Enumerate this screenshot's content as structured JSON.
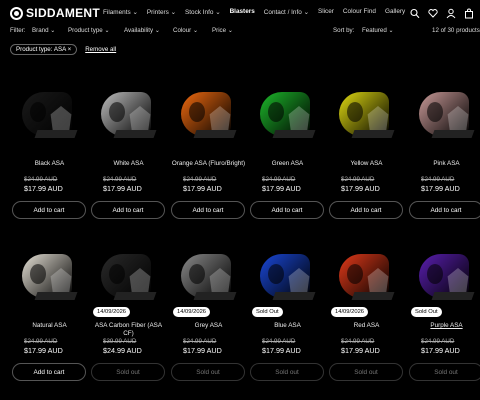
{
  "brand": "SIDDAMENT",
  "nav": [
    "Filaments ⌄",
    "Printers ⌄",
    "Stock Info ⌄",
    "Blasters",
    "Contact / Info ⌄",
    "Slicer",
    "Colour Find",
    "Gallery"
  ],
  "nav_selected": "Blasters",
  "filters": {
    "label": "Filter:",
    "items": [
      "Brand ⌄",
      "Product type ⌄",
      "Availability ⌄",
      "Colour ⌄",
      "Price ⌄"
    ],
    "sort_label": "Sort by:",
    "sort_value": "Featured ⌄",
    "count": "12 of 30 products"
  },
  "active_filter": {
    "chip": "Product type: ASA ×",
    "remove_all": "Remove all"
  },
  "add_label": "Add to cart",
  "soldout_label": "Sold out",
  "products": [
    {
      "name": "Black ASA",
      "old": "$24.99 AUD",
      "new": "$17.99 AUD",
      "color": "#1a1a1a",
      "badge": "",
      "button": "add"
    },
    {
      "name": "White ASA",
      "old": "$24.99 AUD",
      "new": "$17.99 AUD",
      "color": "#bdbdbd",
      "badge": "",
      "button": "add"
    },
    {
      "name": "Orange ASA (Fluro/Bright)",
      "old": "$24.99 AUD",
      "new": "$17.99 AUD",
      "color": "#f06a10",
      "badge": "",
      "button": "add"
    },
    {
      "name": "Green ASA",
      "old": "$24.99 AUD",
      "new": "$17.99 AUD",
      "color": "#1db82b",
      "badge": "",
      "button": "add"
    },
    {
      "name": "Yellow ASA",
      "old": "$24.99 AUD",
      "new": "$17.99 AUD",
      "color": "#e0da12",
      "badge": "",
      "button": "add"
    },
    {
      "name": "Pink ASA",
      "old": "$24.99 AUD",
      "new": "$17.99 AUD",
      "color": "#c99a98",
      "badge": "",
      "button": "add"
    },
    {
      "name": "Natural ASA",
      "old": "$24.99 AUD",
      "new": "$17.99 AUD",
      "color": "#e6e1d6",
      "badge": "",
      "button": "add"
    },
    {
      "name": "ASA Carbon Fiber (ASA CF)",
      "old": "$39.99 AUD",
      "new": "$24.99 AUD",
      "color": "#2a2a2a",
      "badge": "14/09/2026",
      "button": "soldout"
    },
    {
      "name": "Grey ASA",
      "old": "$24.99 AUD",
      "new": "$17.99 AUD",
      "color": "#8a8a8a",
      "badge": "14/09/2026",
      "button": "soldout"
    },
    {
      "name": "Blue ASA",
      "old": "$24.99 AUD",
      "new": "$17.99 AUD",
      "color": "#1a48d8",
      "badge": "Sold Out",
      "button": "soldout"
    },
    {
      "name": "Red ASA",
      "old": "$24.99 AUD",
      "new": "$17.99 AUD",
      "color": "#e23a1a",
      "badge": "14/09/2026",
      "button": "soldout"
    },
    {
      "name": "Purple ASA",
      "old": "$24.99 AUD",
      "new": "$17.99 AUD",
      "color": "#5a1fb0",
      "badge": "Sold Out",
      "button": "soldout"
    }
  ]
}
